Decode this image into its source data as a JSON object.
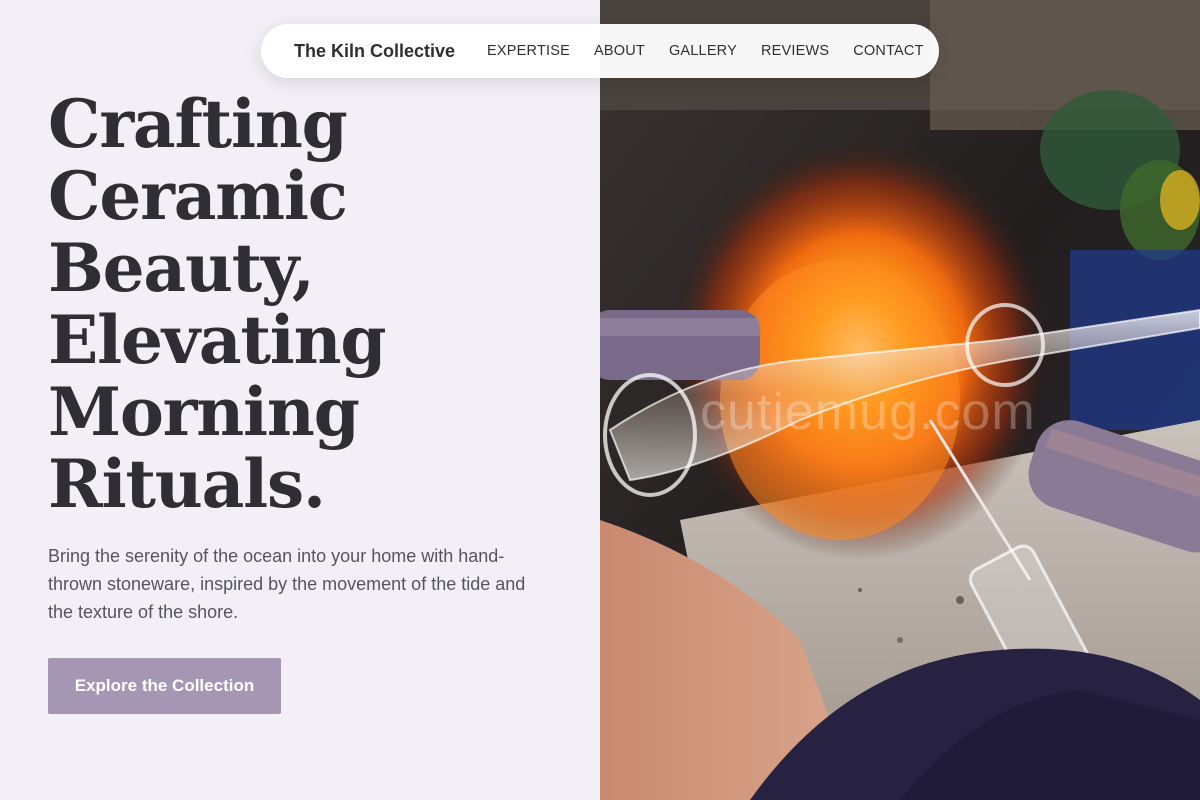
{
  "nav": {
    "brand": "The Kiln Collective",
    "links": [
      "EXPERTISE",
      "ABOUT",
      "GALLERY",
      "REVIEWS",
      "CONTACT"
    ]
  },
  "hero": {
    "title_lines": [
      "Crafting",
      "Ceramic",
      "Beauty,",
      "Elevating",
      "Morning",
      "Rituals."
    ],
    "subtitle": "Bring the serenity of the ocean into your home with hand-thrown stoneware, inspired by the movement of the tide and the texture of the shore.",
    "cta_label": "Explore the Collection"
  },
  "image": {
    "watermark": "cutiemug.com"
  },
  "colors": {
    "background": "#f2eff6",
    "heading": "#2f2f33",
    "body_text": "#55555d",
    "cta": "#a596b4",
    "nav_bg": "#ffffff"
  }
}
